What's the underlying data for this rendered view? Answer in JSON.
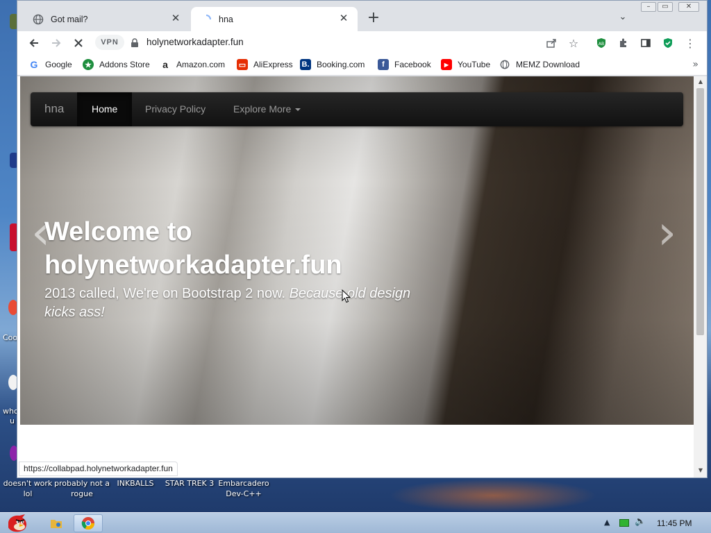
{
  "tabs": [
    {
      "title": "Got mail?",
      "active": false,
      "favicon": "globe-icon"
    },
    {
      "title": "hna",
      "active": true,
      "favicon": "loading-icon"
    }
  ],
  "address_bar": {
    "vpn_label": "VPN",
    "url": "holynetworkadapter.fun"
  },
  "bookmarks": [
    {
      "label": "Google",
      "icon": "google-icon",
      "color": "#4285f4"
    },
    {
      "label": "Addons Store",
      "icon": "addons-store-icon",
      "color": "#1e8e3e"
    },
    {
      "label": "Amazon.com",
      "icon": "amazon-icon",
      "color": "#222222"
    },
    {
      "label": "AliExpress",
      "icon": "aliexpress-icon",
      "color": "#e62e04"
    },
    {
      "label": "Booking.com",
      "icon": "booking-icon",
      "color": "#003580"
    },
    {
      "label": "Facebook",
      "icon": "facebook-icon",
      "color": "#3b5998"
    },
    {
      "label": "YouTube",
      "icon": "youtube-icon",
      "color": "#ff0000"
    },
    {
      "label": "MEMZ Download",
      "icon": "globe-icon",
      "color": "#5f6368"
    }
  ],
  "site": {
    "brand": "hna",
    "nav": [
      {
        "label": "Home",
        "active": true
      },
      {
        "label": "Privacy Policy",
        "active": false
      },
      {
        "label": "Explore More",
        "active": false,
        "dropdown": true
      }
    ],
    "hero": {
      "title": "Welcome to holynetworkadapter.fun",
      "subtitle_plain": "2013 called, We're on Bootstrap 2 now.",
      "subtitle_italic": "Because old design kicks ass!"
    },
    "carousel": {
      "prev": "‹",
      "next": "›"
    }
  },
  "status_url": "https://collabpad.holynetworkadapter.fun",
  "desktop_icons": [
    {
      "label": "doesn't work lol"
    },
    {
      "label": "probably not a rogue"
    },
    {
      "label": "INKBALLS"
    },
    {
      "label": "STAR TREK 3"
    },
    {
      "label": "Embarcadero Dev-C++"
    }
  ],
  "desktop_fragments": {
    "co": "Coo",
    "wh": "who",
    "u": "u"
  },
  "taskbar": {
    "clock": "11:45 PM"
  },
  "colors": {
    "navbar": "#1b1b1b",
    "chrome_tabbar": "#dee1e6",
    "taskbar": "#a9c0dc"
  }
}
